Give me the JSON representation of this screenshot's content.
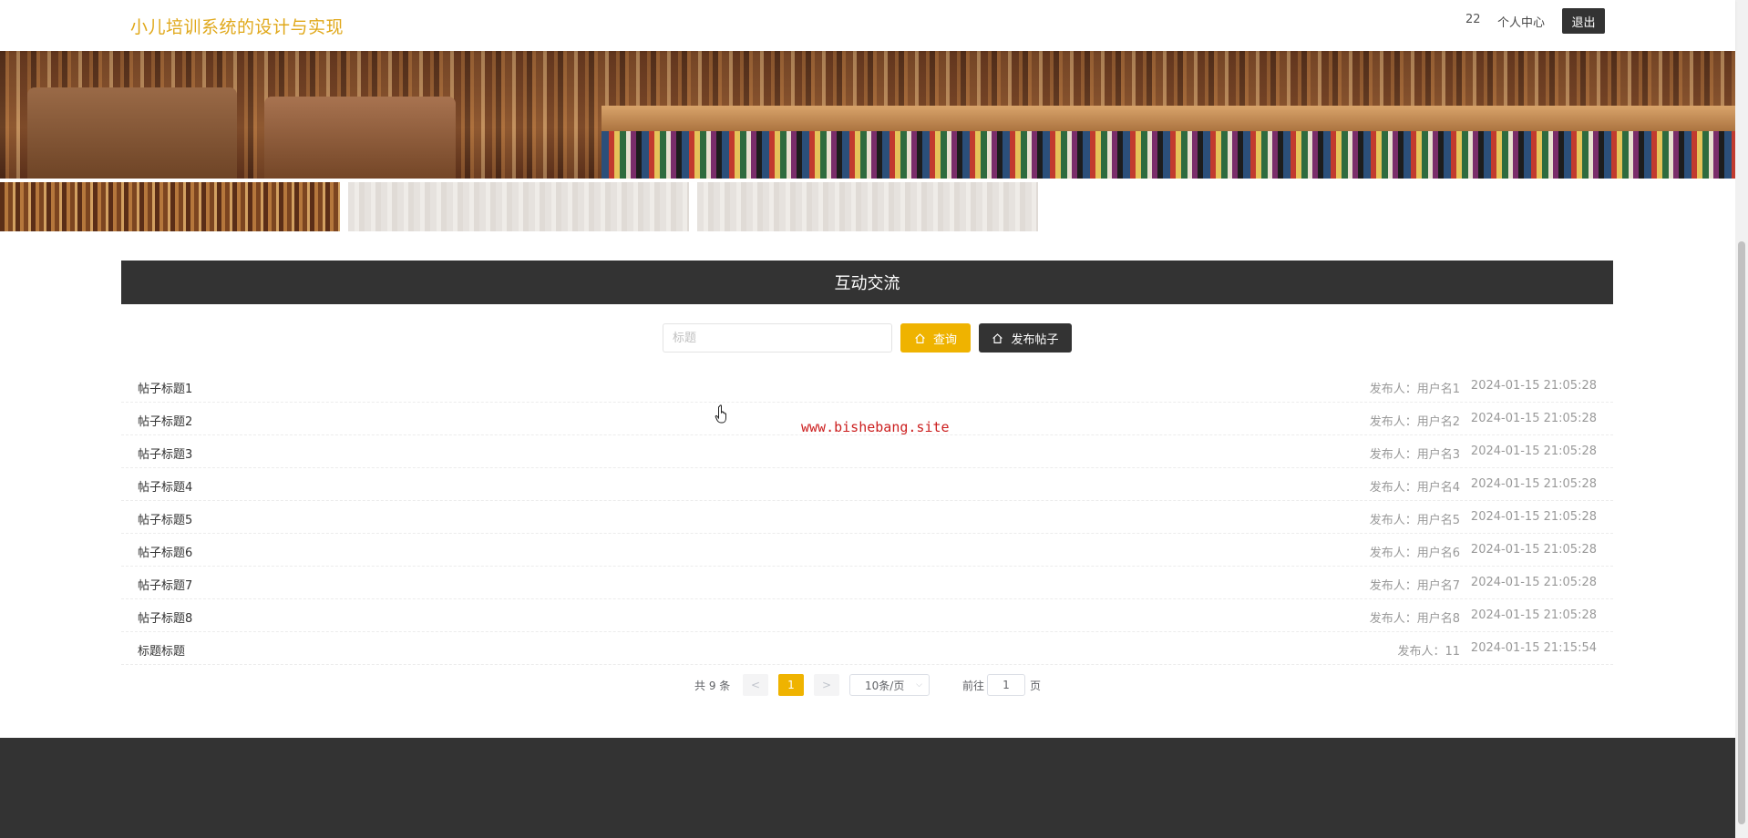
{
  "header": {
    "site_title": "小儿培训系统的设计与实现",
    "user_id": "22",
    "user_center": "个人中心",
    "logout": "退出"
  },
  "section": {
    "title": "互动交流"
  },
  "search": {
    "placeholder": "标题",
    "query_label": "查询",
    "post_label": "发布帖子",
    "query_icon": "home-icon",
    "post_icon": "home-icon"
  },
  "posts": [
    {
      "title": "帖子标题1",
      "author": "发布人：用户名1",
      "time": "2024-01-15 21:05:28"
    },
    {
      "title": "帖子标题2",
      "author": "发布人：用户名2",
      "time": "2024-01-15 21:05:28"
    },
    {
      "title": "帖子标题3",
      "author": "发布人：用户名3",
      "time": "2024-01-15 21:05:28"
    },
    {
      "title": "帖子标题4",
      "author": "发布人：用户名4",
      "time": "2024-01-15 21:05:28"
    },
    {
      "title": "帖子标题5",
      "author": "发布人：用户名5",
      "time": "2024-01-15 21:05:28"
    },
    {
      "title": "帖子标题6",
      "author": "发布人：用户名6",
      "time": "2024-01-15 21:05:28"
    },
    {
      "title": "帖子标题7",
      "author": "发布人：用户名7",
      "time": "2024-01-15 21:05:28"
    },
    {
      "title": "帖子标题8",
      "author": "发布人：用户名8",
      "time": "2024-01-15 21:05:28"
    },
    {
      "title": "标题标题",
      "author": "发布人：11",
      "time": "2024-01-15 21:15:54"
    }
  ],
  "pagination": {
    "total": "共 9 条",
    "prev": "<",
    "current": "1",
    "next": ">",
    "page_size": "10条/页",
    "goto_label": "前往",
    "goto_value": "1",
    "goto_suffix": "页"
  },
  "watermark": "www.bishebang.site",
  "colors": {
    "accent": "#efb300",
    "dark": "#333333",
    "title": "#e0a81a"
  }
}
